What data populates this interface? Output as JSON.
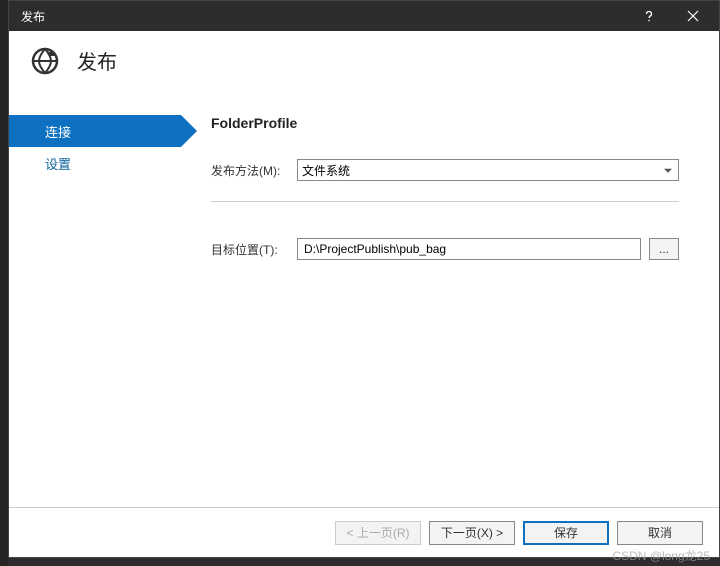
{
  "window": {
    "title": "发布"
  },
  "header": {
    "title": "发布"
  },
  "sidebar": {
    "items": [
      {
        "label": "连接",
        "active": true
      },
      {
        "label": "设置",
        "active": false
      }
    ]
  },
  "content": {
    "profile_name": "FolderProfile",
    "publish_method_label": "发布方法(M):",
    "publish_method_value": "文件系统",
    "target_location_label": "目标位置(T):",
    "target_location_value": "D:\\ProjectPublish\\pub_bag",
    "browse_label": "..."
  },
  "footer": {
    "prev": "< 上一页(R)",
    "next": "下一页(X) >",
    "save": "保存",
    "cancel": "取消"
  },
  "watermark": "CSDN @long龙25"
}
